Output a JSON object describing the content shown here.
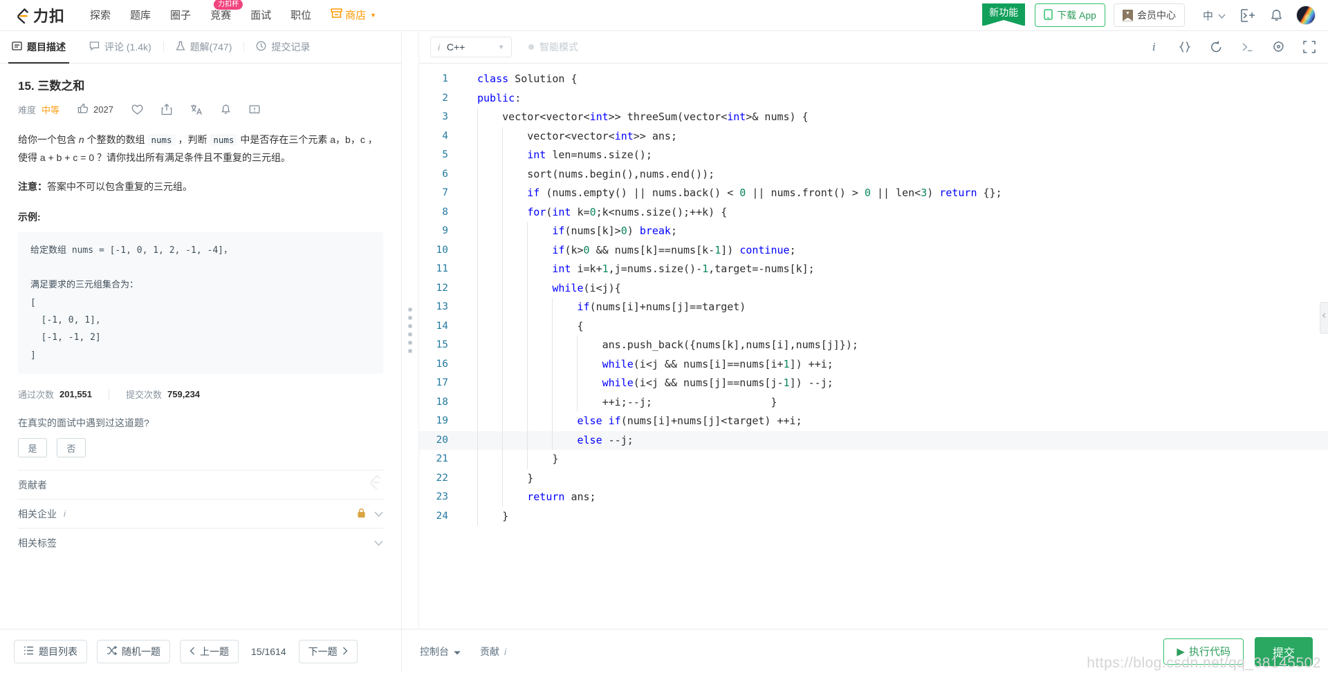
{
  "topnav": {
    "logo_text": "力扣",
    "items": [
      {
        "label": "探索",
        "badge": ""
      },
      {
        "label": "题库",
        "badge": ""
      },
      {
        "label": "圈子",
        "badge": ""
      },
      {
        "label": "竞赛",
        "badge": "力扣杯"
      },
      {
        "label": "面试",
        "badge": ""
      },
      {
        "label": "职位",
        "badge": ""
      }
    ],
    "shop_label": "商店",
    "ribbon_label": "新功能",
    "download_label": "下载 App",
    "vip_label": "会员中心",
    "lang_label": "中",
    "accent_green": "#2ec06c",
    "accent_orange": "#ff9f1a"
  },
  "tabs": [
    {
      "label": "题目描述",
      "icon": "description-icon",
      "active": true
    },
    {
      "label": "评论 (1.4k)",
      "icon": "comment-icon",
      "active": false
    },
    {
      "label": "题解(747)",
      "icon": "flask-icon",
      "active": false
    },
    {
      "label": "提交记录",
      "icon": "clock-icon",
      "active": false
    }
  ],
  "problem": {
    "title": "15. 三数之和",
    "difficulty_label": "难度",
    "difficulty": "中等",
    "likes": "2027",
    "description_part1": "给你一个包含 ",
    "description_n": "n",
    "description_part2": " 个整数的数组 ",
    "code_nums_1": "nums",
    "description_part3": " ，判断 ",
    "code_nums_2": "nums",
    "description_part4": " 中是否存在三个元素 a，b，c ，使得 a + b + c = 0 ？请你找出所有满足条件且不重复的三元组。",
    "note_label": "注意：",
    "note_text": "答案中不可以包含重复的三元组。",
    "example_title": "示例:",
    "example_body": "给定数组 nums = [-1, 0, 1, 2, -1, -4]，\n\n满足要求的三元组集合为：\n[\n  [-1, 0, 1],\n  [-1, -1, 2]\n]",
    "stat_accepted_label": "通过次数",
    "stat_accepted_value": "201,551",
    "stat_submitted_label": "提交次数",
    "stat_submitted_value": "759,234",
    "interview_question": "在真实的面试中遇到过这道题?",
    "yes_label": "是",
    "no_label": "否",
    "accordion": [
      {
        "label": "贡献者",
        "locked": false,
        "has_info": false,
        "has_chevron": false
      },
      {
        "label": "相关企业",
        "locked": true,
        "has_info": true,
        "has_chevron": true
      },
      {
        "label": "相关标签",
        "locked": false,
        "has_info": false,
        "has_chevron": true
      }
    ]
  },
  "editor": {
    "language": "C++",
    "smart_mode_label": "智能模式",
    "active_line": 20,
    "lines": [
      {
        "n": 1,
        "guides": 0,
        "segs": [
          {
            "t": "class",
            "c": "kw"
          },
          {
            "t": " Solution {",
            "c": "pl"
          }
        ]
      },
      {
        "n": 2,
        "guides": 0,
        "segs": [
          {
            "t": "public",
            "c": "kw"
          },
          {
            "t": ":",
            "c": "pl"
          }
        ]
      },
      {
        "n": 3,
        "guides": 1,
        "segs": [
          {
            "t": "    vector<vector<",
            "c": "pl"
          },
          {
            "t": "int",
            "c": "ty"
          },
          {
            "t": ">> threeSum(vector<",
            "c": "pl"
          },
          {
            "t": "int",
            "c": "ty"
          },
          {
            "t": ">& nums) {",
            "c": "pl"
          }
        ]
      },
      {
        "n": 4,
        "guides": 2,
        "segs": [
          {
            "t": "        vector<vector<",
            "c": "pl"
          },
          {
            "t": "int",
            "c": "ty"
          },
          {
            "t": ">> ans;",
            "c": "pl"
          }
        ]
      },
      {
        "n": 5,
        "guides": 2,
        "segs": [
          {
            "t": "        ",
            "c": "pl"
          },
          {
            "t": "int",
            "c": "ty"
          },
          {
            "t": " len=nums.size();",
            "c": "pl"
          }
        ]
      },
      {
        "n": 6,
        "guides": 2,
        "segs": [
          {
            "t": "        sort(nums.begin(),nums.end());",
            "c": "pl"
          }
        ]
      },
      {
        "n": 7,
        "guides": 2,
        "segs": [
          {
            "t": "        ",
            "c": "pl"
          },
          {
            "t": "if",
            "c": "kw"
          },
          {
            "t": " (nums.empty() || nums.back() < ",
            "c": "pl"
          },
          {
            "t": "0",
            "c": "num"
          },
          {
            "t": " || nums.front() > ",
            "c": "pl"
          },
          {
            "t": "0",
            "c": "num"
          },
          {
            "t": " || len<",
            "c": "pl"
          },
          {
            "t": "3",
            "c": "num"
          },
          {
            "t": ") ",
            "c": "pl"
          },
          {
            "t": "return",
            "c": "kw"
          },
          {
            "t": " {};",
            "c": "pl"
          }
        ]
      },
      {
        "n": 8,
        "guides": 2,
        "segs": [
          {
            "t": "        ",
            "c": "pl"
          },
          {
            "t": "for",
            "c": "kw"
          },
          {
            "t": "(",
            "c": "pl"
          },
          {
            "t": "int",
            "c": "ty"
          },
          {
            "t": " k=",
            "c": "pl"
          },
          {
            "t": "0",
            "c": "num"
          },
          {
            "t": ";k<nums.size();++k) {",
            "c": "pl"
          }
        ]
      },
      {
        "n": 9,
        "guides": 3,
        "segs": [
          {
            "t": "            ",
            "c": "pl"
          },
          {
            "t": "if",
            "c": "kw"
          },
          {
            "t": "(nums[k]>",
            "c": "pl"
          },
          {
            "t": "0",
            "c": "num"
          },
          {
            "t": ") ",
            "c": "pl"
          },
          {
            "t": "break",
            "c": "kw"
          },
          {
            "t": ";",
            "c": "pl"
          }
        ]
      },
      {
        "n": 10,
        "guides": 3,
        "segs": [
          {
            "t": "            ",
            "c": "pl"
          },
          {
            "t": "if",
            "c": "kw"
          },
          {
            "t": "(k>",
            "c": "pl"
          },
          {
            "t": "0",
            "c": "num"
          },
          {
            "t": " && nums[k]==nums[k-",
            "c": "pl"
          },
          {
            "t": "1",
            "c": "num"
          },
          {
            "t": "]) ",
            "c": "pl"
          },
          {
            "t": "continue",
            "c": "kw"
          },
          {
            "t": ";",
            "c": "pl"
          }
        ]
      },
      {
        "n": 11,
        "guides": 3,
        "segs": [
          {
            "t": "            ",
            "c": "pl"
          },
          {
            "t": "int",
            "c": "ty"
          },
          {
            "t": " i=k+",
            "c": "pl"
          },
          {
            "t": "1",
            "c": "num"
          },
          {
            "t": ",j=nums.size()-",
            "c": "pl"
          },
          {
            "t": "1",
            "c": "num"
          },
          {
            "t": ",target=-nums[k];",
            "c": "pl"
          }
        ]
      },
      {
        "n": 12,
        "guides": 3,
        "segs": [
          {
            "t": "            ",
            "c": "pl"
          },
          {
            "t": "while",
            "c": "kw"
          },
          {
            "t": "(i<j){",
            "c": "pl"
          }
        ]
      },
      {
        "n": 13,
        "guides": 4,
        "segs": [
          {
            "t": "                ",
            "c": "pl"
          },
          {
            "t": "if",
            "c": "kw"
          },
          {
            "t": "(nums[i]+nums[j]==target)",
            "c": "pl"
          }
        ]
      },
      {
        "n": 14,
        "guides": 4,
        "segs": [
          {
            "t": "                {",
            "c": "pl"
          }
        ]
      },
      {
        "n": 15,
        "guides": 5,
        "segs": [
          {
            "t": "                    ans.push_back({nums[k],nums[i],nums[j]});",
            "c": "pl"
          }
        ]
      },
      {
        "n": 16,
        "guides": 5,
        "segs": [
          {
            "t": "                    ",
            "c": "pl"
          },
          {
            "t": "while",
            "c": "kw"
          },
          {
            "t": "(i<j && nums[i]==nums[i+",
            "c": "pl"
          },
          {
            "t": "1",
            "c": "num"
          },
          {
            "t": "]) ++i;",
            "c": "pl"
          }
        ]
      },
      {
        "n": 17,
        "guides": 5,
        "segs": [
          {
            "t": "                    ",
            "c": "pl"
          },
          {
            "t": "while",
            "c": "kw"
          },
          {
            "t": "(i<j && nums[j]==nums[j-",
            "c": "pl"
          },
          {
            "t": "1",
            "c": "num"
          },
          {
            "t": "]) --j;",
            "c": "pl"
          }
        ]
      },
      {
        "n": 18,
        "guides": 5,
        "segs": [
          {
            "t": "                    ++i;--j;                   }",
            "c": "pl"
          }
        ]
      },
      {
        "n": 19,
        "guides": 4,
        "segs": [
          {
            "t": "                ",
            "c": "pl"
          },
          {
            "t": "else",
            "c": "kw"
          },
          {
            "t": " ",
            "c": "pl"
          },
          {
            "t": "if",
            "c": "kw"
          },
          {
            "t": "(nums[i]+nums[j]<target) ++i;",
            "c": "pl"
          }
        ]
      },
      {
        "n": 20,
        "guides": 4,
        "segs": [
          {
            "t": "                ",
            "c": "pl"
          },
          {
            "t": "else",
            "c": "kw"
          },
          {
            "t": " --j;",
            "c": "pl"
          }
        ]
      },
      {
        "n": 21,
        "guides": 3,
        "segs": [
          {
            "t": "            }",
            "c": "pl"
          }
        ]
      },
      {
        "n": 22,
        "guides": 2,
        "segs": [
          {
            "t": "        }",
            "c": "pl"
          }
        ]
      },
      {
        "n": 23,
        "guides": 2,
        "segs": [
          {
            "t": "        ",
            "c": "pl"
          },
          {
            "t": "return",
            "c": "kw"
          },
          {
            "t": " ans;",
            "c": "pl"
          }
        ]
      },
      {
        "n": 24,
        "guides": 1,
        "segs": [
          {
            "t": "    }",
            "c": "pl"
          }
        ]
      }
    ]
  },
  "bottom": {
    "list_label": "题目列表",
    "random_label": "随机一题",
    "prev_label": "上一题",
    "pager": "15/1614",
    "next_label": "下一题",
    "console_label": "控制台",
    "contribute_label": "贡献",
    "run_label": "执行代码",
    "submit_label": "提交"
  },
  "watermark": "https://blog.csdn.net/qq_38145502"
}
